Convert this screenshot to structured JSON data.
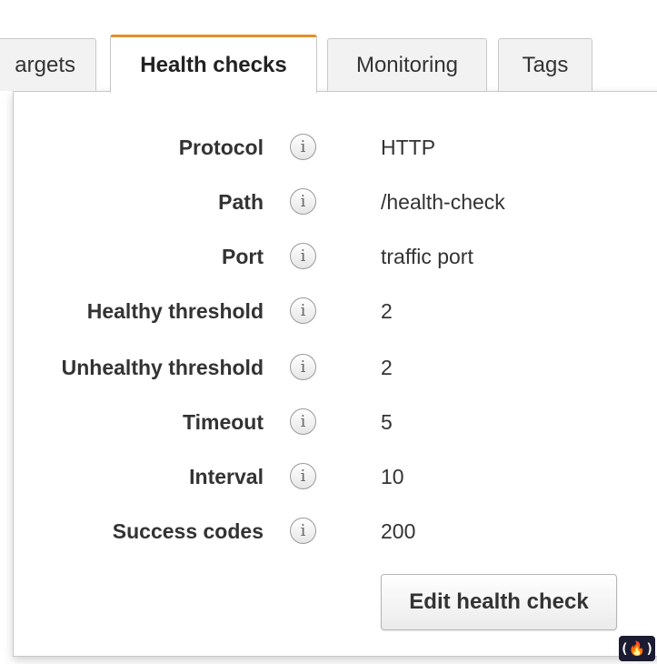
{
  "tabs": [
    {
      "label": "argets",
      "active": false
    },
    {
      "label": "Health checks",
      "active": true
    },
    {
      "label": "Monitoring",
      "active": false
    },
    {
      "label": "Tags",
      "active": false
    }
  ],
  "health_checks": {
    "fields": [
      {
        "label": "Protocol",
        "value": "HTTP"
      },
      {
        "label": "Path",
        "value": "/health-check"
      },
      {
        "label": "Port",
        "value": "traffic port"
      },
      {
        "label": "Healthy threshold",
        "value": "2"
      },
      {
        "label": "Unhealthy threshold",
        "value": "2"
      },
      {
        "label": "Timeout",
        "value": "5"
      },
      {
        "label": "Interval",
        "value": "10"
      },
      {
        "label": "Success codes",
        "value": "200"
      }
    ],
    "info_icon_glyph": "i",
    "edit_button_label": "Edit health check"
  },
  "watermark": {
    "glyph": "(🔥)"
  },
  "colors": {
    "active_tab_accent": "#e58f2b",
    "watermark_bg": "#1b1b32"
  }
}
